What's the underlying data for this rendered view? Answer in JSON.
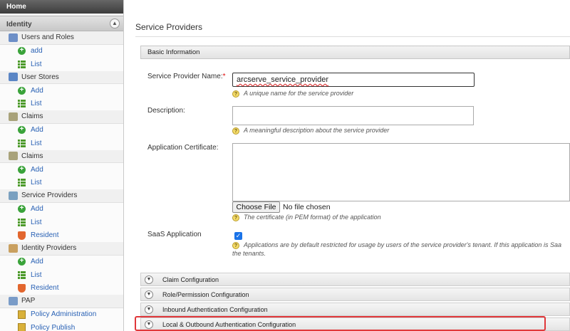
{
  "sidebar": {
    "home": "Home",
    "identity": "Identity",
    "groups": [
      {
        "label": "Users and Roles",
        "icon": "users-icon",
        "items": [
          {
            "label": "add",
            "icon": "add-icon"
          },
          {
            "label": "List",
            "icon": "list-icon"
          }
        ]
      },
      {
        "label": "User Stores",
        "icon": "user-store-icon",
        "items": [
          {
            "label": "Add",
            "icon": "add-icon"
          },
          {
            "label": "List",
            "icon": "list-icon"
          }
        ]
      },
      {
        "label": "Claims",
        "icon": "claims-icon",
        "items": [
          {
            "label": "Add",
            "icon": "add-icon"
          },
          {
            "label": "List",
            "icon": "list-icon"
          }
        ]
      },
      {
        "label": "Claims",
        "icon": "claims-icon",
        "items": [
          {
            "label": "Add",
            "icon": "add-icon"
          },
          {
            "label": "List",
            "icon": "list-icon"
          }
        ]
      },
      {
        "label": "Service Providers",
        "icon": "service-providers-icon",
        "items": [
          {
            "label": "Add",
            "icon": "add-icon"
          },
          {
            "label": "List",
            "icon": "list-icon"
          },
          {
            "label": "Resident",
            "icon": "resident-icon"
          }
        ]
      },
      {
        "label": "Identity Providers",
        "icon": "identity-providers-icon",
        "items": [
          {
            "label": "Add",
            "icon": "add-icon"
          },
          {
            "label": "List",
            "icon": "list-icon"
          },
          {
            "label": "Resident",
            "icon": "resident-icon"
          }
        ]
      },
      {
        "label": "PAP",
        "icon": "pap-icon",
        "items": [
          {
            "label": "Policy Administration",
            "icon": "policy-icon"
          },
          {
            "label": "Policy Publish",
            "icon": "policy-icon"
          }
        ]
      }
    ]
  },
  "main": {
    "title": "Service Providers",
    "basic_info": "Basic Information",
    "sp_name_label": "Service Provider Name:",
    "required_mark": "*",
    "sp_name_value": "arcserve_service_provider",
    "sp_name_help": "A unique name for the service provider",
    "description_label": "Description:",
    "description_help": "A meaningful description about the service provider",
    "cert_label": "Application Certificate:",
    "choose_file": "Choose File",
    "no_file": "No file chosen",
    "cert_help": "The certificate (in PEM format) of the application",
    "saas_label": "SaaS Application",
    "saas_help_line1": "Applications are by default restricted for usage by users of the service provider's tenant. If this application is Saa",
    "saas_help_line2": "the tenants.",
    "accordions": [
      "Claim Configuration",
      "Role/Permission Configuration",
      "Inbound Authentication Configuration",
      "Local & Outbound Authentication Configuration"
    ]
  },
  "colors": {
    "link": "#2a62b5",
    "highlight": "#e0373a",
    "checkbox": "#1a73e8"
  }
}
